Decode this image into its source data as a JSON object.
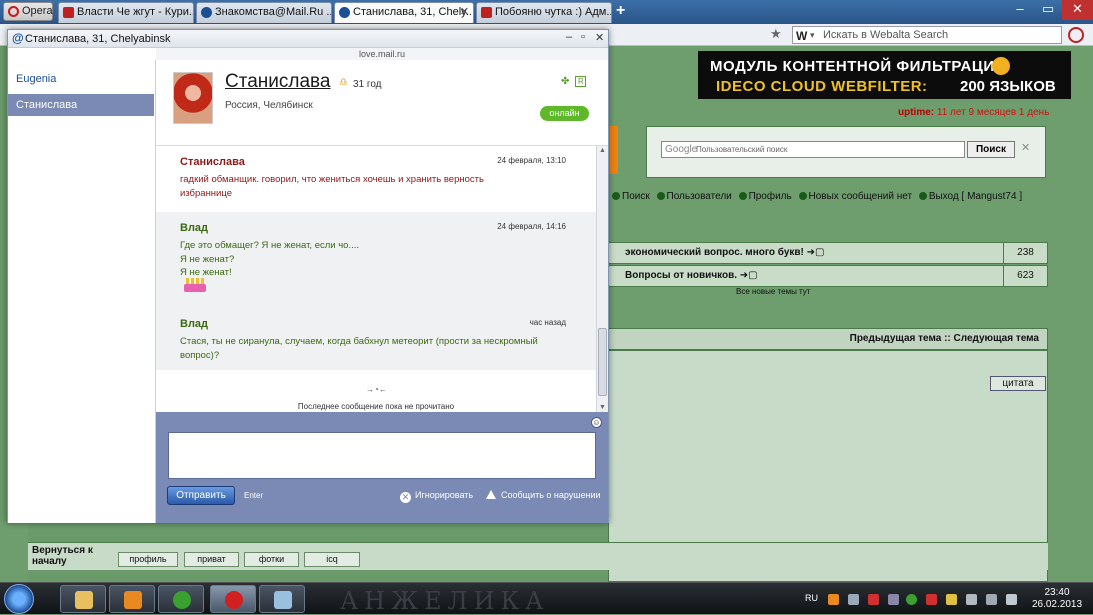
{
  "browser": {
    "opera_label": "Opera",
    "tabs": [
      {
        "label": "Власти Че жгут - Кури..."
      },
      {
        "label": "Знакомства@Mail.Ru ..."
      },
      {
        "label": "Станислава, 31, Chely..."
      },
      {
        "label": "Побояню чутка :) Адм..."
      }
    ],
    "new_tab": "+",
    "search_placeholder": "Искать в Webalta Search"
  },
  "forum": {
    "banner": {
      "line1": "МОДУЛЬ КОНТЕНТНОЙ ФИЛЬТРАЦИИ",
      "line2": "IDECO CLOUD WEBFILTER:",
      "line3": "200 ЯЗЫКОВ"
    },
    "uptime_label": "uptime:",
    "uptime_value": "11 лет 9 месяцев 1 день",
    "google_label": "Google",
    "search_placeholder": "Пользовательский поиск",
    "search_button": "Поиск",
    "nav": {
      "search": "Поиск",
      "users": "Пользователи",
      "profile": "Профиль",
      "no_new": "Новых сообщений нет",
      "logout": "Выход [ Mangust74 ]"
    },
    "topics": [
      {
        "title": "экономический вопрос. много букв! ➜▢",
        "count": "238"
      },
      {
        "title": "Вопросы от новичков. ➜▢",
        "count": "623"
      }
    ],
    "all_new": "Все новые темы тут",
    "prev_next": "Предыдущая тема :: Следующая тема",
    "quote_button": "цитата",
    "back_to_top": "Вернуться к началу",
    "buttons": {
      "profile": "профиль",
      "private": "приват",
      "photos": "фотки",
      "icq": "icq"
    }
  },
  "chat": {
    "window_title": "Станислава, 31, Chelyabinsk",
    "domain": "love.mail.ru",
    "contacts": [
      {
        "name": "Eugenia",
        "selected": false
      },
      {
        "name": "Станислава",
        "selected": true
      }
    ],
    "profile": {
      "name": "Станислава",
      "age": "31 год",
      "location": "Россия, Челябинск",
      "status": "онлайн",
      "r_badge": "R"
    },
    "messages": [
      {
        "author": "Станислава",
        "time": "24 февраля, 13:10",
        "lines": [
          "гадкий обманщик. говорил, что жениться хочешь и хранить верность",
          "избраннице"
        ]
      },
      {
        "author": "Влад",
        "time": "24 февраля, 14:16",
        "lines": [
          "Где это обмащег? Я не женат, если чо....",
          "Я не женат?",
          "Я не женат!"
        ]
      },
      {
        "author": "Влад",
        "time": "час назад",
        "lines": [
          "Стася, ты не сиранула, случаем, когда бабхнул метеорит (прости за нескромный",
          "вопрос)?"
        ]
      }
    ],
    "read_status": "Последнее сообщение пока не прочитано",
    "composer": {
      "input_value": "",
      "send_label": "Отправить",
      "enter_hint": "Enter",
      "ignore_label": "Игнорировать",
      "report_label": "Сообщить о нарушении"
    }
  },
  "taskbar": {
    "language": "RU",
    "time": "23:40",
    "date": "26.02.2013",
    "wallpaper_text": "АНЖЕЛИКА"
  }
}
